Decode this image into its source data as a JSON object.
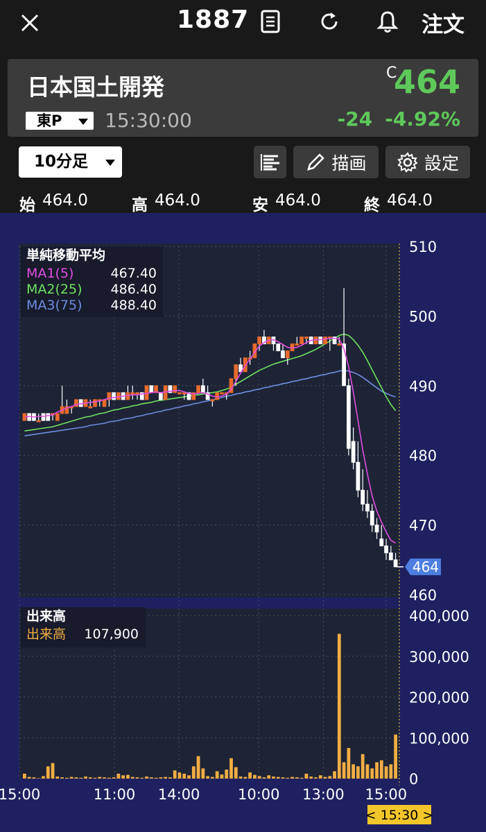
{
  "header": {
    "close_icon": "close-icon",
    "code": "1887",
    "doc_icon": "document-icon",
    "refresh_icon": "refresh-icon",
    "bell_icon": "bell-icon",
    "order_label": "注文"
  },
  "quote": {
    "name": "日本国土開発",
    "c_mark": "C",
    "price": "464",
    "market": "東P",
    "time": "15:30:00",
    "change": "-24",
    "change_pct": "-4.92%",
    "up_color": "#5ec95a"
  },
  "toolbar": {
    "timeframe": "10分足",
    "draw_label": "描画",
    "settings_label": "設定"
  },
  "ohlc": [
    {
      "label": "始",
      "value": "464.0"
    },
    {
      "label": "高",
      "value": "464.0"
    },
    {
      "label": "安",
      "value": "464.0"
    },
    {
      "label": "終",
      "value": "464.0"
    }
  ],
  "main_panel": {
    "title": "単純移動平均",
    "ma": [
      {
        "name": "MA1(5)",
        "value": "467.40",
        "color": "#e24de0"
      },
      {
        "name": "MA2(25)",
        "value": "486.40",
        "color": "#6fe35f"
      },
      {
        "name": "MA3(75)",
        "value": "488.40",
        "color": "#6f8ee0"
      }
    ],
    "price_tag": "464"
  },
  "volume_panel": {
    "title": "出来高",
    "series_name": "出来高",
    "value": "107,900",
    "color": "#f2ae43"
  },
  "current_time_tag": "< 15:30 >",
  "chart_data": {
    "type": "candlestick+bar",
    "price_axis": {
      "ticks": [
        "510",
        "500",
        "490",
        "480",
        "470",
        "460"
      ],
      "range": [
        460,
        510
      ]
    },
    "volume_axis": {
      "ticks": [
        "400,000",
        "300,000",
        "200,000",
        "100,000",
        "0"
      ],
      "range": [
        0,
        400000
      ]
    },
    "x_ticks": [
      "15:00",
      "11:00",
      "14:00",
      "10:00",
      "13:00",
      "15:00"
    ],
    "price_x": [
      0,
      1,
      2,
      3,
      4,
      5,
      6,
      7,
      8,
      9,
      10,
      11,
      12,
      13,
      14,
      15,
      16,
      17,
      18,
      19,
      20,
      21,
      22,
      23,
      24,
      25,
      26,
      27,
      28,
      29,
      30,
      31,
      32,
      33,
      34,
      35,
      36,
      37,
      38,
      39,
      40,
      41,
      42,
      43,
      44,
      45,
      46,
      47,
      48,
      49,
      50,
      51,
      52,
      53,
      54,
      55,
      56,
      57,
      58,
      59,
      60,
      61,
      62,
      63,
      64,
      65,
      66,
      67,
      68,
      69,
      70,
      71,
      72,
      73,
      74,
      75,
      76,
      77,
      78,
      79,
      80,
      81,
      82,
      83,
      84,
      85,
      86,
      87,
      88,
      89,
      90,
      91,
      92,
      93,
      94,
      95,
      96,
      97,
      98,
      99,
      100
    ],
    "candles": [
      [
        485,
        486,
        485,
        486
      ],
      [
        486,
        486,
        485,
        485
      ],
      [
        486,
        486,
        485,
        485
      ],
      [
        485,
        486,
        485,
        485
      ],
      [
        486,
        486,
        485,
        485
      ],
      [
        486,
        486,
        485,
        485
      ],
      [
        486,
        486,
        485,
        486
      ],
      [
        485,
        486,
        485,
        486
      ],
      [
        486,
        490,
        486,
        487
      ],
      [
        486,
        488,
        486,
        487
      ],
      [
        487,
        487,
        486,
        487
      ],
      [
        487,
        488,
        487,
        488
      ],
      [
        488,
        488,
        487,
        487
      ],
      [
        487,
        488,
        487,
        488
      ],
      [
        487,
        488,
        487,
        487
      ],
      [
        487,
        488,
        487,
        488
      ],
      [
        488,
        488,
        487,
        488
      ],
      [
        487,
        488,
        487,
        488
      ],
      [
        488,
        489,
        487,
        489
      ],
      [
        489,
        489,
        488,
        488
      ],
      [
        488,
        489,
        488,
        489
      ],
      [
        489,
        489,
        488,
        488
      ],
      [
        488,
        490,
        488,
        489
      ],
      [
        489,
        490,
        488,
        489
      ],
      [
        489,
        489,
        488,
        489
      ],
      [
        489,
        489,
        488,
        488
      ],
      [
        488,
        490,
        488,
        490
      ],
      [
        490,
        490,
        489,
        489
      ],
      [
        489,
        490,
        489,
        490
      ],
      [
        489,
        489,
        488,
        488
      ],
      [
        488,
        490,
        488,
        490
      ],
      [
        490,
        490,
        489,
        489
      ],
      [
        489,
        490,
        489,
        490
      ],
      [
        489,
        489,
        489,
        489
      ],
      [
        489,
        489,
        488,
        489
      ],
      [
        489,
        489,
        488,
        488
      ],
      [
        488,
        489,
        488,
        489
      ],
      [
        489,
        490,
        489,
        490
      ],
      [
        490,
        491,
        489,
        489
      ],
      [
        489,
        490,
        488,
        488
      ],
      [
        488,
        488,
        487,
        488
      ],
      [
        488,
        489,
        488,
        489
      ],
      [
        489,
        489,
        489,
        489
      ],
      [
        489,
        489,
        488,
        489
      ],
      [
        489,
        491,
        489,
        491
      ],
      [
        491,
        493,
        490,
        493
      ],
      [
        493,
        494,
        492,
        492
      ],
      [
        492,
        494,
        492,
        494
      ],
      [
        494,
        495,
        493,
        494
      ],
      [
        494,
        496,
        494,
        496
      ],
      [
        496,
        497,
        495,
        497
      ],
      [
        497,
        498,
        496,
        496
      ],
      [
        496,
        497,
        496,
        497
      ],
      [
        497,
        497,
        495,
        496
      ],
      [
        496,
        496,
        495,
        495
      ],
      [
        495,
        496,
        494,
        494
      ],
      [
        494,
        495,
        493,
        495
      ],
      [
        495,
        496,
        495,
        496
      ],
      [
        496,
        497,
        496,
        496
      ],
      [
        496,
        497,
        496,
        497
      ],
      [
        497,
        497,
        496,
        497
      ],
      [
        497,
        497,
        496,
        496
      ],
      [
        496,
        497,
        496,
        497
      ],
      [
        497,
        497,
        496,
        496
      ],
      [
        496,
        497,
        496,
        497
      ],
      [
        497,
        497,
        495,
        497
      ],
      [
        497,
        497,
        496,
        496
      ],
      [
        496,
        497,
        496,
        496
      ],
      [
        496,
        504,
        490,
        490
      ],
      [
        490,
        491,
        480,
        481
      ],
      [
        482,
        484,
        478,
        479
      ],
      [
        479,
        482,
        474,
        475
      ],
      [
        475,
        478,
        472,
        473
      ],
      [
        473,
        475,
        471,
        472
      ],
      [
        472,
        473,
        469,
        470
      ],
      [
        470,
        471,
        468,
        469
      ],
      [
        468,
        470,
        467,
        467
      ],
      [
        467,
        468,
        465,
        466
      ],
      [
        466,
        467,
        465,
        465
      ],
      [
        465,
        466,
        464,
        464
      ]
    ],
    "ma1": [
      485.5,
      485.6,
      485.5,
      485.6,
      485.6,
      485.7,
      485.8,
      486.2,
      486.5,
      486.8,
      487.0,
      487.3,
      487.4,
      487.5,
      487.6,
      487.7,
      487.8,
      488.0,
      488.2,
      488.3,
      488.4,
      488.5,
      488.6,
      488.7,
      488.7,
      488.8,
      488.9,
      489.0,
      489.1,
      489.0,
      489.1,
      489.2,
      489.3,
      489.3,
      489.1,
      488.9,
      488.8,
      488.9,
      489.0,
      488.8,
      488.5,
      488.4,
      488.5,
      488.8,
      489.5,
      490.6,
      491.8,
      492.9,
      493.8,
      494.8,
      495.7,
      496.2,
      496.5,
      496.6,
      496.3,
      495.9,
      495.5,
      495.4,
      495.5,
      495.8,
      496.2,
      496.5,
      496.6,
      496.6,
      496.7,
      496.8,
      496.8,
      496.7,
      495.3,
      492.7,
      489.1,
      485.0,
      480.8,
      477.3,
      474.2,
      472.0,
      470.4,
      469.0,
      467.8,
      467.4
    ],
    "ma2": [
      483.5,
      483.6,
      483.7,
      483.8,
      483.9,
      484.0,
      484.1,
      484.3,
      484.5,
      484.7,
      484.9,
      485.1,
      485.3,
      485.5,
      485.6,
      485.8,
      486.0,
      486.1,
      486.3,
      486.5,
      486.6,
      486.8,
      486.9,
      487.1,
      487.2,
      487.4,
      487.5,
      487.6,
      487.8,
      487.9,
      488.0,
      488.1,
      488.2,
      488.3,
      488.4,
      488.5,
      488.6,
      488.7,
      488.8,
      488.9,
      489.0,
      489.1,
      489.3,
      489.5,
      489.8,
      490.2,
      490.6,
      491.0,
      491.4,
      491.8,
      492.2,
      492.5,
      492.8,
      493.1,
      493.3,
      493.5,
      493.7,
      493.9,
      494.1,
      494.3,
      494.6,
      494.9,
      495.2,
      495.6,
      496.0,
      496.4,
      496.8,
      497.2,
      497.4,
      497.2,
      496.6,
      495.8,
      494.8,
      493.6,
      492.3,
      491.0,
      489.7,
      488.4,
      487.3,
      486.4
    ],
    "ma3": [
      482.8,
      482.9,
      483.0,
      483.1,
      483.2,
      483.3,
      483.4,
      483.5,
      483.6,
      483.7,
      483.8,
      483.9,
      484.0,
      484.1,
      484.3,
      484.4,
      484.5,
      484.6,
      484.8,
      484.9,
      485.0,
      485.2,
      485.3,
      485.4,
      485.6,
      485.7,
      485.9,
      486.0,
      486.2,
      486.3,
      486.5,
      486.6,
      486.8,
      486.9,
      487.1,
      487.2,
      487.4,
      487.5,
      487.7,
      487.8,
      488.0,
      488.1,
      488.3,
      488.5,
      488.6,
      488.8,
      488.9,
      489.1,
      489.2,
      489.4,
      489.5,
      489.7,
      489.8,
      490.0,
      490.1,
      490.3,
      490.4,
      490.6,
      490.7,
      490.9,
      491.0,
      491.2,
      491.3,
      491.5,
      491.6,
      491.8,
      491.9,
      492.1,
      492.2,
      492.1,
      491.9,
      491.6,
      491.2,
      490.7,
      490.2,
      489.7,
      489.2,
      488.9,
      488.6,
      488.4
    ],
    "volume": [
      12000,
      4000,
      3000,
      1000,
      6000,
      30000,
      38000,
      5000,
      3000,
      2000,
      4000,
      3000,
      2000,
      5000,
      3000,
      2000,
      4000,
      3000,
      2000,
      3000,
      12000,
      8000,
      9000,
      4000,
      3000,
      2000,
      5000,
      3000,
      2000,
      3000,
      4000,
      3000,
      20000,
      15000,
      12000,
      8000,
      30000,
      55000,
      25000,
      6000,
      4000,
      18000,
      10000,
      22000,
      50000,
      28000,
      5000,
      4000,
      15000,
      9000,
      6000,
      3000,
      8000,
      5000,
      4000,
      3000,
      2000,
      4000,
      3000,
      2000,
      12000,
      5000,
      3000,
      8000,
      4000,
      6000,
      18000,
      355000,
      40000,
      75000,
      35000,
      30000,
      60000,
      35000,
      25000,
      40000,
      45000,
      30000,
      35000,
      107900
    ]
  }
}
